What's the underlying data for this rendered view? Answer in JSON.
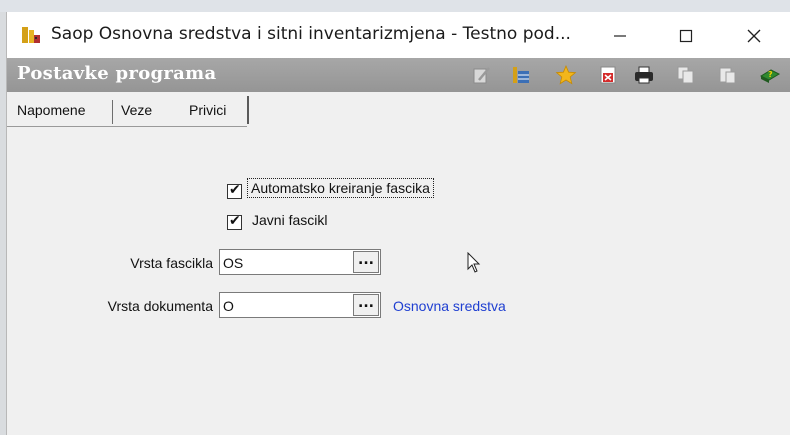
{
  "window": {
    "title": "Saop Osnovna sredstva i sitni inventarizmjena  - Testno pod...",
    "minimize_glyph": "—",
    "maximize_glyph": "☐",
    "close_glyph": "✕"
  },
  "header": {
    "title": "Postavke programa",
    "toolbar_icons": [
      "edit-icon",
      "table-icon",
      "star-icon",
      "delete-icon",
      "print-icon",
      "copy-icon",
      "paste-icon",
      "help-book-icon"
    ]
  },
  "tabs": [
    {
      "label": "Napomene",
      "active": false
    },
    {
      "label": "Veze",
      "active": false
    },
    {
      "label": "Privici",
      "active": true
    }
  ],
  "form": {
    "auto_create_folder": {
      "label": "Automatsko kreiranje fascika",
      "checked": true
    },
    "public_folder": {
      "label": "Javni fascikl",
      "checked": true
    },
    "folder_type": {
      "label": "Vrsta fascikla",
      "value": "OS",
      "button": "..."
    },
    "document_type": {
      "label": "Vrsta dokumenta",
      "value": "O",
      "button": "...",
      "description": "Osnovna sredstva"
    }
  },
  "colors": {
    "header_bg": "#a0a0a0",
    "link_blue": "#1f3fd1",
    "window_bg": "#f0f0f0"
  }
}
